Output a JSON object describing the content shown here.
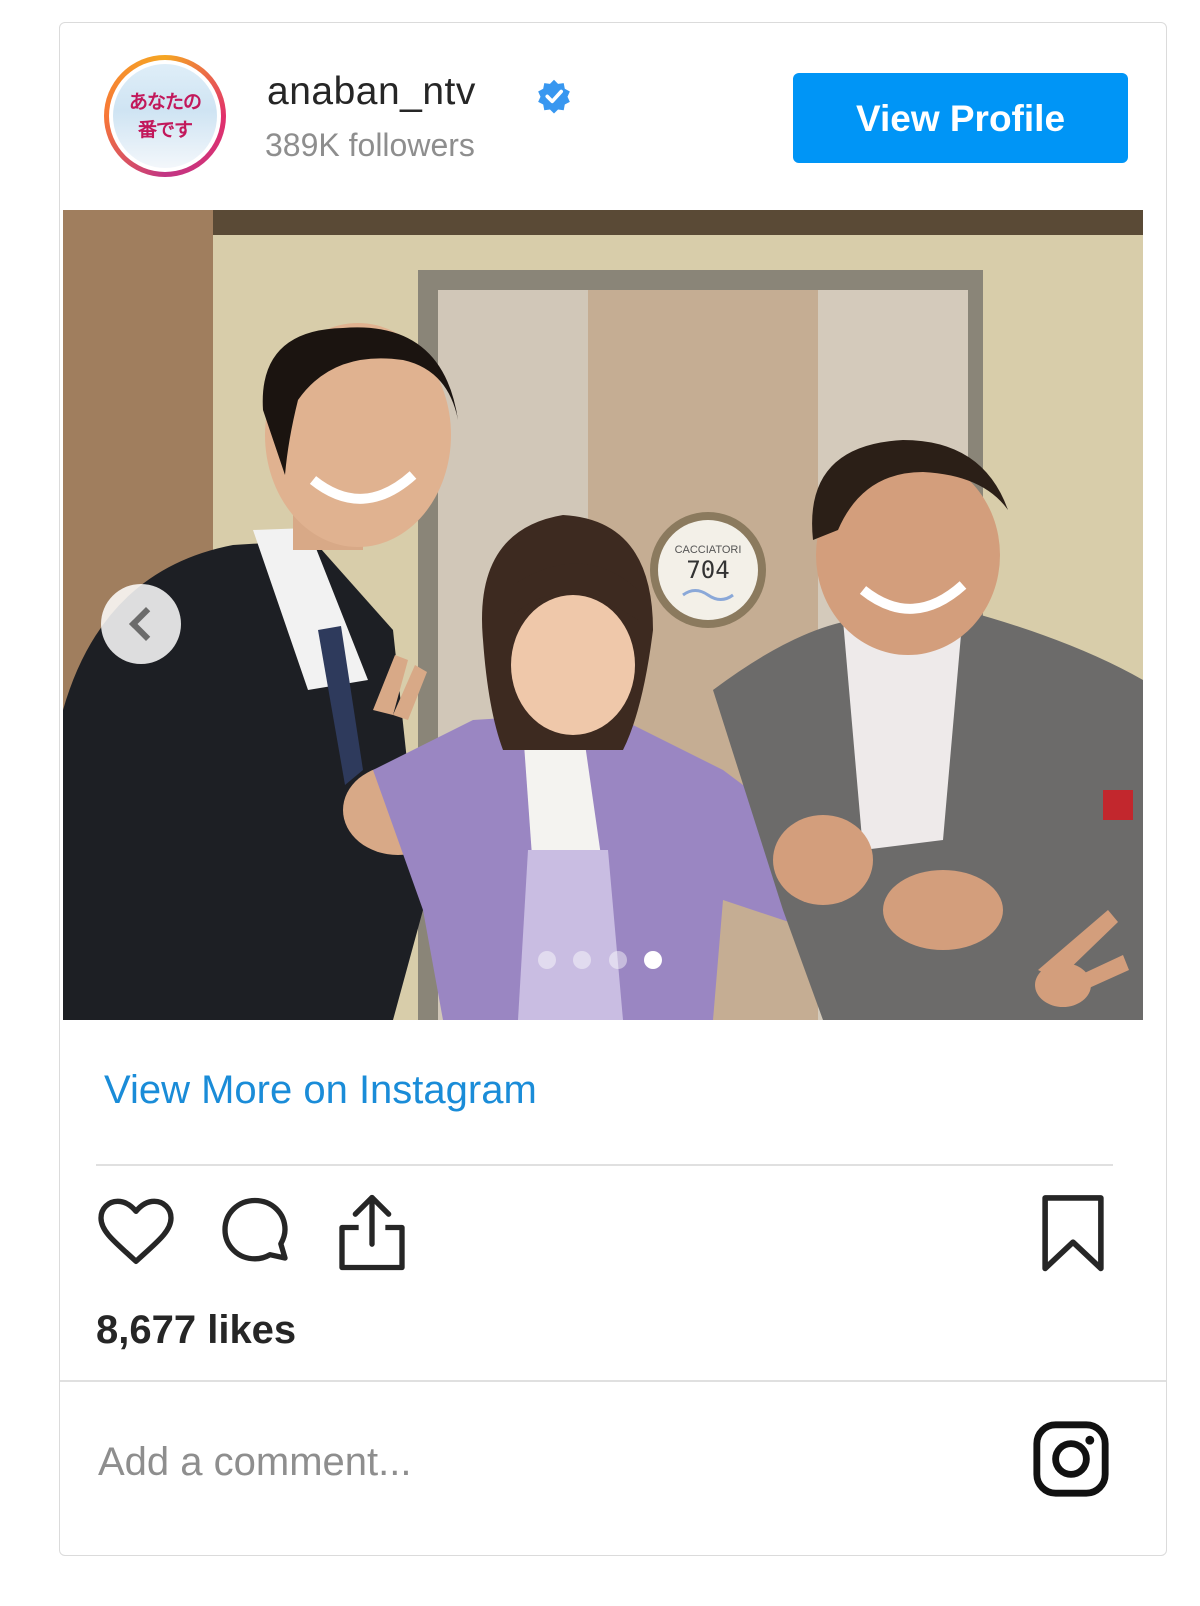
{
  "header": {
    "avatar_text": "あなたの\n番です",
    "username": "anaban_ntv",
    "followers": "389K followers",
    "view_profile_label": "View Profile"
  },
  "photo": {
    "door_sign_brand": "CACCIATORI",
    "door_sign_number": "704",
    "carousel_dots": 4,
    "active_dot": 4
  },
  "links": {
    "view_more": "View More on Instagram"
  },
  "actions": {
    "icons": [
      "heart-icon",
      "comment-icon",
      "share-icon",
      "bookmark-icon"
    ]
  },
  "likes": "8,677 likes",
  "comment": {
    "placeholder": "Add a comment..."
  },
  "colors": {
    "primary_blue": "#0095f6",
    "link_blue": "#1a8cd8",
    "text": "#262626",
    "muted": "#8e8e8e"
  }
}
